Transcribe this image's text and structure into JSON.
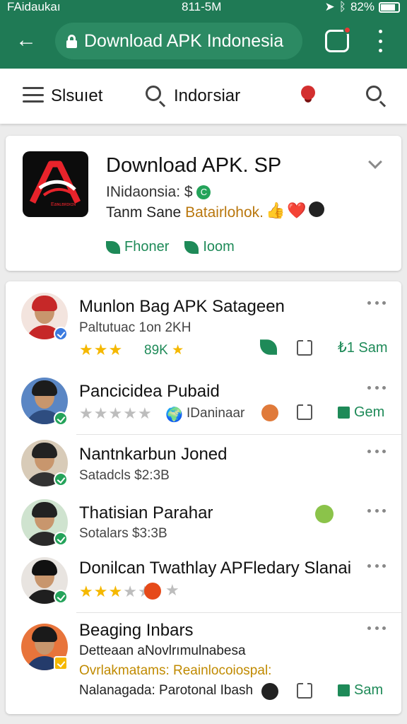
{
  "status_bar": {
    "carrier": "FAidaukaı",
    "time": "811-5M",
    "battery": "82%",
    "battery_level": 0.82
  },
  "header": {
    "back_label": "←",
    "url": "Download APK Indonesia"
  },
  "toolbar": {
    "left_label": "Slsuıet",
    "search_label": "Indoᴦsiar"
  },
  "app": {
    "title": "Download APK. SP",
    "subtitle": "INidaonsia: $",
    "subtitle_badge": "C",
    "tagline_prefix": "Tanm Sane ",
    "tagline_highlight": "Batairlohok.",
    "emoji": [
      "👍",
      "❤️"
    ],
    "icon_caption": "Eаɴʟʙʀɪᴋɪɴ",
    "actions": [
      {
        "label": "Fhoner"
      },
      {
        "label": "Ioom"
      }
    ]
  },
  "items": [
    {
      "name": "Munlon Bag APK Satageen",
      "meta": "Paltutuac 1on 2KH",
      "rating": 3,
      "rating_text": "89K",
      "action_label": "₺1 Sam"
    },
    {
      "name": "Pancicidea Pubaid",
      "meta": "IDaninaar",
      "rating": 0,
      "action_label": "Gem"
    },
    {
      "name": "Nantnkarbun Joned",
      "meta": "Satadcls $2:3B"
    },
    {
      "name": "Thatisian Parahar",
      "meta": "Sotalars $3:3B"
    },
    {
      "name": "Donilcan Twathlay APFledary Slanai",
      "rating": 3
    },
    {
      "name": "Beaging Inbars",
      "line1": "Detteaan aNovlrımulnabesa",
      "line2": "Ovrlakmatams: Reainlocoiospal:",
      "line3": "Nalanagada: Parotonal Ibash",
      "action_label": "Sam"
    }
  ],
  "colors": {
    "brand_green": "#1f7a55",
    "accent_green": "#1e8a58",
    "star_gold": "#f5b800",
    "badge_blue": "#3b7be0"
  }
}
